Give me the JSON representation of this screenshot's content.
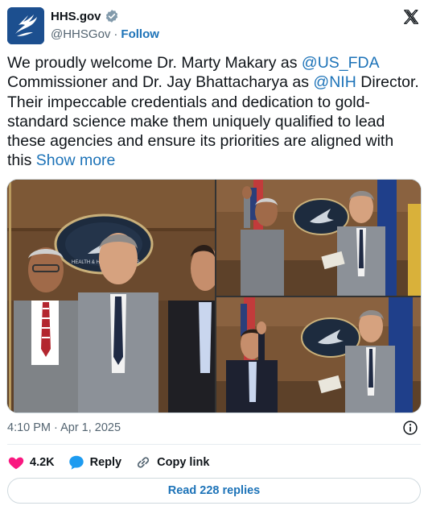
{
  "account": {
    "name": "HHS.gov",
    "handle": "@HHSGov",
    "separator": "·",
    "follow_label": "Follow",
    "verified_badge_color": "#829aab",
    "avatar_color": "#1c4f8f"
  },
  "tweet": {
    "text_part1": "We proudly welcome Dr. Marty Makary as ",
    "mention1": "@US_FDA",
    "text_part2": " Commissioner and Dr. Jay Bhattacharya as ",
    "mention2": "@NIH",
    "text_part3": " Director. Their impeccable credentials and dedication to gold-standard science make them uniquely qualified to lead these agencies and ensure its priorities are aligned with this ",
    "show_more": "Show more",
    "link_color": "#1d73b8"
  },
  "media": {
    "photos": [
      {
        "description_icon": "photo-group"
      },
      {
        "description_icon": "photo-swearing-in-1"
      },
      {
        "description_icon": "photo-swearing-in-2"
      }
    ],
    "seal_text": "HEALTH & HUMAN SERVICES"
  },
  "meta": {
    "timestamp": "4:10 PM · Apr 1, 2025"
  },
  "actions": {
    "likes_count": "4.2K",
    "reply_label": "Reply",
    "copy_link_label": "Copy link",
    "like_color": "#f91880",
    "reply_color": "#1d9bf0"
  },
  "replies_button": {
    "label": "Read 228 replies"
  }
}
